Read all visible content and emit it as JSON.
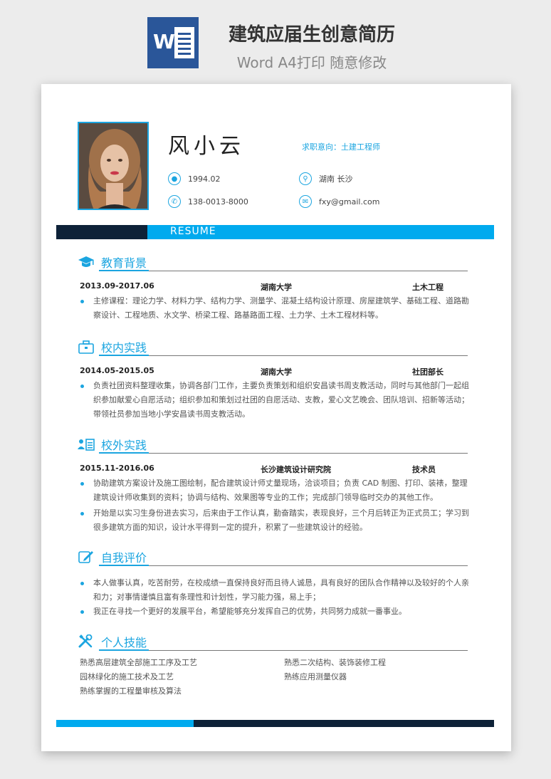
{
  "banner": {
    "logo_letter": "W",
    "title": "建筑应届生创意简历",
    "subtitle": "Word A4打印 随意修改"
  },
  "profile": {
    "name": "风小云",
    "job_intent": "求职意向：土建工程师",
    "birth": "1994.02",
    "location": "湖南 长沙",
    "phone": "138-0013-8000",
    "email": "fxy@gmail.com"
  },
  "resume_label": "RESUME",
  "education": {
    "title": "教育背景",
    "date": "2013.09-2017.06",
    "school": "湖南大学",
    "major": "土木工程",
    "bullets": [
      "主修课程：理论力学、材料力学、结构力学、测量学、混凝土结构设计原理、房屋建筑学、基础工程、道路勘",
      "察设计、工程地质、水文学、桥梁工程、路基路面工程、土力学、土木工程材料等。"
    ]
  },
  "campus": {
    "title": "校内实践",
    "date": "2014.05-2015.05",
    "org": "湖南大学",
    "role": "社团部长",
    "lines": [
      "负责社团资料整理收集，协调各部门工作，主要负责策划和组织安昌读书周支教活动，同时与其他部门一起组",
      "织参加献爱心自愿活动；组织参加和策划过社团的自愿活动、支教，爱心文艺晚会、团队培训、招新等活动；",
      "带领社员参加当地小学安昌读书周支教活动。"
    ]
  },
  "external": {
    "title": "校外实践",
    "date": "2015.11-2016.06",
    "org": "长沙建筑设计研究院",
    "role": "技术员",
    "item1": [
      "协助建筑方案设计及施工图绘制，配合建筑设计师丈量现场，洽谈项目；负责 CAD 制图、打印、装裱，整理",
      "建筑设计师收集到的资料；协调与结构、效果图等专业的工作；完成部门领导临时交办的其他工作。"
    ],
    "item2": [
      "开始是以实习生身份进去实习，后来由于工作认真，勤奋踏实，表现良好，三个月后转正为正式员工；学习到",
      "很多建筑方面的知识，设计水平得到一定的提升，积累了一些建筑设计的经验。"
    ]
  },
  "self": {
    "title": "自我评价",
    "item1": [
      "本人做事认真，吃苦耐劳，在校成绩一直保持良好而且待人诚恳，具有良好的团队合作精神以及较好的个人亲",
      "和力；对事情谨慎且富有条理性和计划性，学习能力强，易上手；"
    ],
    "item2": [
      "我正在寻找一个更好的发展平台，希望能够充分发挥自己的优势，共同努力成就一番事业。"
    ]
  },
  "skills": {
    "title": "个人技能",
    "left": [
      "熟悉高层建筑全部施工工序及工艺",
      "园林绿化的施工技术及工艺",
      "熟练掌握的工程量审核及算法"
    ],
    "right": [
      "熟悉二次结构、装饰装修工程",
      "熟练应用测量仪器"
    ]
  },
  "colors": {
    "accent": "#1ba5e0",
    "bar_blue": "#00aaee",
    "dark_navy": "#0e2238",
    "word_blue": "#2a5699"
  },
  "icons": [
    "word-logo-icon",
    "user-icon",
    "location-icon",
    "phone-icon",
    "email-icon",
    "graduation-cap-icon",
    "briefcase-icon",
    "people-list-icon",
    "edit-icon",
    "tools-icon"
  ]
}
